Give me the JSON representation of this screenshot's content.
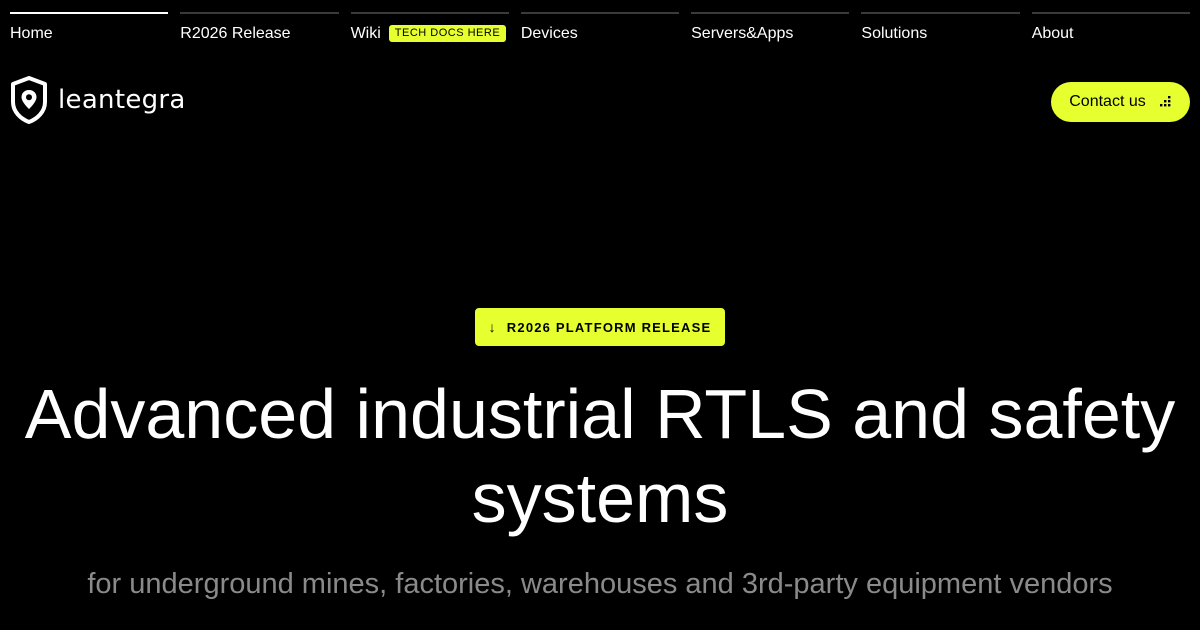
{
  "nav": {
    "items": [
      {
        "label": "Home",
        "active": true
      },
      {
        "label": "R2026 Release"
      },
      {
        "label": "Wiki",
        "badge": "TECH DOCS HERE"
      },
      {
        "label": "Devices"
      },
      {
        "label": "Servers&Apps"
      },
      {
        "label": "Solutions"
      },
      {
        "label": "About"
      }
    ]
  },
  "header": {
    "logo_text": "leantegra",
    "logo_icon": "shield-location-icon",
    "contact_label": "Contact us",
    "contact_icon": "dots-icon"
  },
  "hero": {
    "badge_icon": "arrow-down-icon",
    "badge_arrow": "↓",
    "badge_label": "R2026 PLATFORM RELEASE",
    "title": "Advanced industrial RTLS and safety systems",
    "subtitle": "for underground mines, factories, warehouses and 3rd-party equipment vendors"
  },
  "colors": {
    "background": "#000000",
    "accent": "#e6ff2e",
    "text": "#ffffff",
    "muted": "#8a8a8a"
  }
}
